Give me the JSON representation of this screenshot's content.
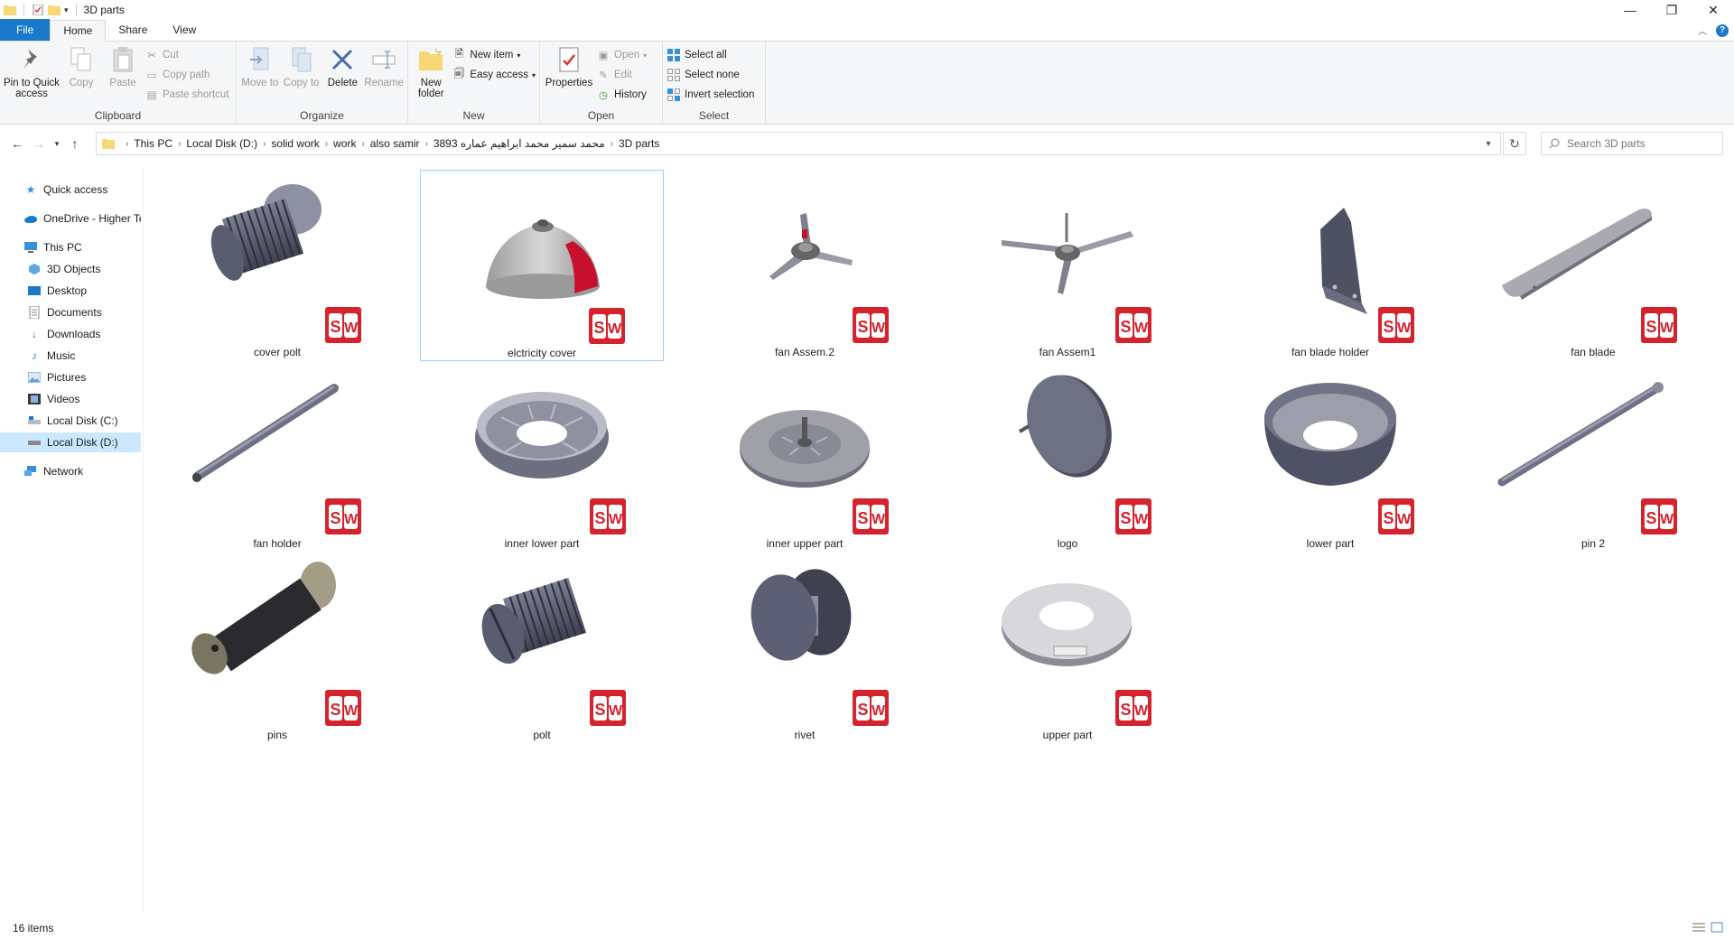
{
  "window": {
    "title": "3D parts",
    "controls": [
      "minimize",
      "restore",
      "close"
    ]
  },
  "ribbon_tabs": [
    {
      "label": "File"
    },
    {
      "label": "Home"
    },
    {
      "label": "Share"
    },
    {
      "label": "View"
    }
  ],
  "ribbon": {
    "clipboard": {
      "label": "Clipboard",
      "pin": "Pin to Quick access",
      "copy": "Copy",
      "paste": "Paste",
      "cut": "Cut",
      "copy_path": "Copy path",
      "paste_shortcut": "Paste shortcut"
    },
    "organize": {
      "label": "Organize",
      "move_to": "Move to",
      "copy_to": "Copy to",
      "delete": "Delete",
      "rename": "Rename"
    },
    "new": {
      "label": "New",
      "new_folder": "New folder",
      "new_item": "New item",
      "easy_access": "Easy access"
    },
    "open": {
      "label": "Open",
      "properties": "Properties",
      "open": "Open",
      "edit": "Edit",
      "history": "History"
    },
    "select": {
      "label": "Select",
      "select_all": "Select all",
      "select_none": "Select none",
      "invert": "Invert selection"
    }
  },
  "address": {
    "crumbs": [
      "This PC",
      "Local Disk (D:)",
      "solid work",
      "work",
      "also samir",
      "محمد سمير محمد ابراهيم عماره 3893",
      "3D parts"
    ]
  },
  "search": {
    "placeholder": "Search 3D parts"
  },
  "nav": {
    "quick_access": "Quick access",
    "onedrive": "OneDrive - Higher Te",
    "this_pc": "This PC",
    "objects3d": "3D Objects",
    "desktop": "Desktop",
    "documents": "Documents",
    "downloads": "Downloads",
    "music": "Music",
    "pictures": "Pictures",
    "videos": "Videos",
    "disk_c": "Local Disk (C:)",
    "disk_d": "Local Disk (D:)",
    "network": "Network"
  },
  "files": [
    {
      "name": "cover polt",
      "thumb": "bolt-icon"
    },
    {
      "name": "elctricity cover",
      "thumb": "dome-icon"
    },
    {
      "name": "fan Assem.2",
      "thumb": "fan-icon"
    },
    {
      "name": "fan Assem1",
      "thumb": "fan-icon"
    },
    {
      "name": "fan blade holder",
      "thumb": "bracket-icon"
    },
    {
      "name": "fan blade",
      "thumb": "blade-icon"
    },
    {
      "name": "fan holder",
      "thumb": "rod-icon"
    },
    {
      "name": "inner lower part",
      "thumb": "ring-icon"
    },
    {
      "name": "inner upper part",
      "thumb": "plate-icon"
    },
    {
      "name": "logo",
      "thumb": "disc-icon"
    },
    {
      "name": "lower part",
      "thumb": "bowl-icon"
    },
    {
      "name": "pin 2",
      "thumb": "rod-icon"
    },
    {
      "name": "pins",
      "thumb": "pin-icon"
    },
    {
      "name": "polt",
      "thumb": "bolt-icon"
    },
    {
      "name": "rivet",
      "thumb": "rivet-icon"
    },
    {
      "name": "upper part",
      "thumb": "washer-icon"
    }
  ],
  "status": {
    "count": "16 items"
  },
  "colors": {
    "file_tab": "#1979ca",
    "selection": "#cce8ff",
    "sw_red": "#d5232e"
  }
}
